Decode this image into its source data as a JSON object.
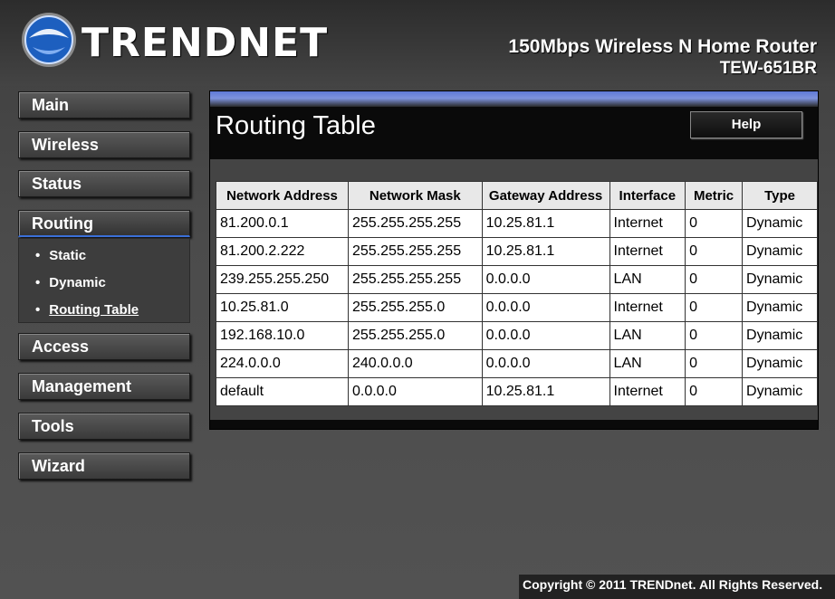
{
  "header": {
    "brand": "TRENDNET",
    "product_line": "150Mbps Wireless N Home Router",
    "model": "TEW-651BR"
  },
  "sidebar": {
    "items": [
      {
        "label": "Main"
      },
      {
        "label": "Wireless"
      },
      {
        "label": "Status"
      },
      {
        "label": "Routing"
      },
      {
        "label": "Access"
      },
      {
        "label": "Management"
      },
      {
        "label": "Tools"
      },
      {
        "label": "Wizard"
      }
    ],
    "routing_sub": [
      {
        "label": "Static"
      },
      {
        "label": "Dynamic"
      },
      {
        "label": "Routing Table"
      }
    ]
  },
  "main": {
    "title": "Routing Table",
    "help_label": "Help"
  },
  "table": {
    "headers": [
      "Network Address",
      "Network Mask",
      "Gateway Address",
      "Interface",
      "Metric",
      "Type"
    ],
    "rows": [
      [
        "81.200.0.1",
        "255.255.255.255",
        "10.25.81.1",
        "Internet",
        "0",
        "Dynamic"
      ],
      [
        "81.200.2.222",
        "255.255.255.255",
        "10.25.81.1",
        "Internet",
        "0",
        "Dynamic"
      ],
      [
        "239.255.255.250",
        "255.255.255.255",
        "0.0.0.0",
        "LAN",
        "0",
        "Dynamic"
      ],
      [
        "10.25.81.0",
        "255.255.255.0",
        "0.0.0.0",
        "Internet",
        "0",
        "Dynamic"
      ],
      [
        "192.168.10.0",
        "255.255.255.0",
        "0.0.0.0",
        "LAN",
        "0",
        "Dynamic"
      ],
      [
        "224.0.0.0",
        "240.0.0.0",
        "0.0.0.0",
        "LAN",
        "0",
        "Dynamic"
      ],
      [
        "default",
        "0.0.0.0",
        "10.25.81.1",
        "Internet",
        "0",
        "Dynamic"
      ]
    ]
  },
  "footer": {
    "copyright": "Copyright © 2011 TRENDnet. All Rights Reserved."
  },
  "colors": {
    "accent_blue": "#3a6fd8",
    "panel_bar": "#6f86da"
  }
}
